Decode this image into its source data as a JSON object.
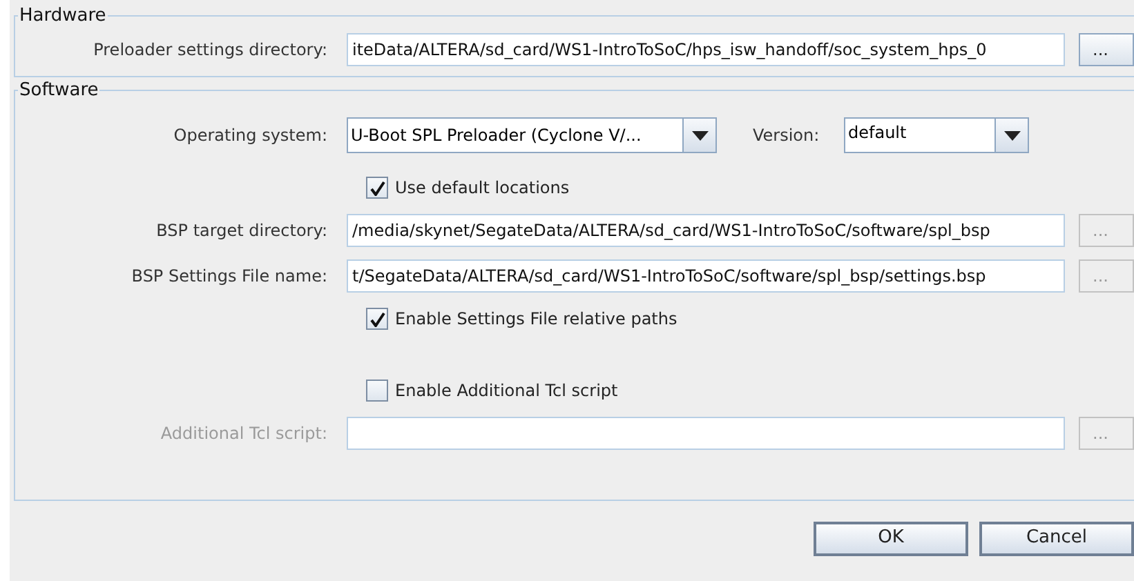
{
  "hardware": {
    "title": "Hardware",
    "rows": [
      {
        "kind": "path",
        "label": "Preloader settings directory:",
        "value": "iteData/ALTERA/sd_card/WS1-IntroToSoC/hps_isw_handoff/soc_system_hps_0",
        "browse": "...",
        "disabled": false
      }
    ]
  },
  "software": {
    "title": "Software",
    "os": {
      "label": "Operating system:",
      "value": "U-Boot SPL Preloader (Cyclone V/..."
    },
    "version": {
      "label": "Version:",
      "value": "default"
    },
    "rows": [
      {
        "kind": "check",
        "label": "Use default locations",
        "checked": true
      },
      {
        "kind": "path",
        "label": "BSP target directory:",
        "value": "/media/skynet/SegateData/ALTERA/sd_card/WS1-IntroToSoC/software/spl_bsp",
        "browse": "...",
        "disabled": true
      },
      {
        "kind": "path",
        "label": "BSP Settings File name:",
        "value": "t/SegateData/ALTERA/sd_card/WS1-IntroToSoC/software/spl_bsp/settings.bsp",
        "browse": "...",
        "disabled": true
      },
      {
        "kind": "check",
        "label": "Enable Settings File relative paths",
        "checked": true
      },
      {
        "kind": "spacer"
      },
      {
        "kind": "check",
        "label": "Enable Additional Tcl script",
        "checked": false
      },
      {
        "kind": "path",
        "label": "Additional Tcl script:",
        "value": "",
        "browse": "...",
        "disabled": true,
        "label_disabled": true
      }
    ]
  },
  "buttons": [
    "OK",
    "Cancel"
  ]
}
